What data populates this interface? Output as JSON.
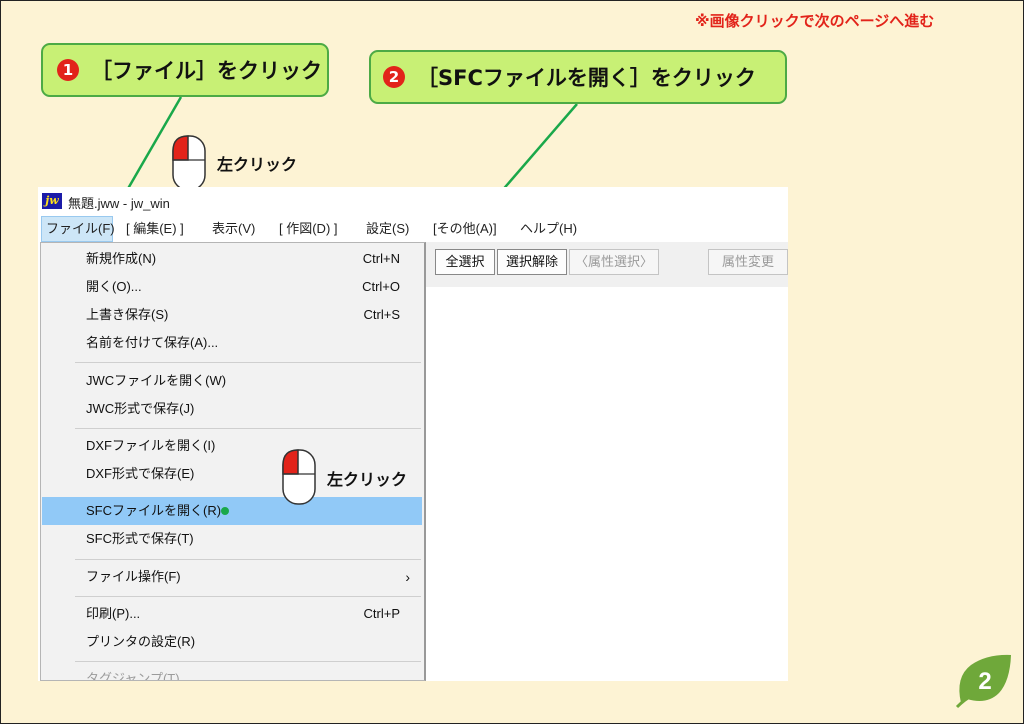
{
  "hint": "※画像クリックで次のページへ進む",
  "callouts": [
    {
      "num": "1",
      "text": "［ファイル］をクリック"
    },
    {
      "num": "2",
      "text": "［SFCファイルを開く］をクリック"
    }
  ],
  "click_label": "左クリック",
  "window": {
    "icon_text": "jw",
    "title": "無題.jww - jw_win",
    "menu": [
      "ファイル(F)",
      "[ 編集(E) ]",
      "表示(V)",
      "[ 作図(D) ]",
      "設定(S)",
      "[その他(A)]",
      "ヘルプ(H)"
    ],
    "toolbar": [
      "全選択",
      "選択解除",
      "〈属性選択〉",
      "属性変更"
    ],
    "file_menu": [
      {
        "label": "新規作成(N)",
        "shortcut": "Ctrl+N"
      },
      {
        "label": "開く(O)...",
        "shortcut": "Ctrl+O"
      },
      {
        "label": "上書き保存(S)",
        "shortcut": "Ctrl+S"
      },
      {
        "label": "名前を付けて保存(A)...",
        "shortcut": ""
      },
      {
        "label": "JWCファイルを開く(W)",
        "shortcut": ""
      },
      {
        "label": "JWC形式で保存(J)",
        "shortcut": ""
      },
      {
        "label": "DXFファイルを開く(I)",
        "shortcut": ""
      },
      {
        "label": "DXF形式で保存(E)",
        "shortcut": ""
      },
      {
        "label": "SFCファイルを開く(R)",
        "shortcut": ""
      },
      {
        "label": "SFC形式で保存(T)",
        "shortcut": ""
      },
      {
        "label": "ファイル操作(F)",
        "shortcut": "›"
      },
      {
        "label": "印刷(P)...",
        "shortcut": "Ctrl+P"
      },
      {
        "label": "プリンタの設定(R)",
        "shortcut": ""
      },
      {
        "label": "タグジャンプ(T)",
        "shortcut": ""
      }
    ]
  },
  "page_number": "2",
  "colors": {
    "background": "#fdf3d4",
    "callout_fill": "#c8f075",
    "callout_border": "#4caa45",
    "accent_red": "#e2231a",
    "highlight": "#91c9f7"
  }
}
